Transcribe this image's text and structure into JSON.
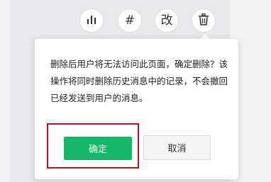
{
  "toolbar": {
    "buttons": [
      {
        "label": "",
        "icon": "bar-chart-icon"
      },
      {
        "label": "#",
        "icon": "hash-icon"
      },
      {
        "label": "改",
        "icon": "edit-text-icon"
      },
      {
        "label": "",
        "icon": "trash-icon"
      }
    ]
  },
  "dialog": {
    "message": "删除后用户将无法访问此页面，确定删除？该操作将同时删除历史消息中的记录，不会撤回已经发送到用户的消息。",
    "confirm_label": "确定",
    "cancel_label": "取消"
  },
  "colors": {
    "primary": "#13b866",
    "highlight_border": "#b4141b",
    "background": "#e9e9eb"
  }
}
